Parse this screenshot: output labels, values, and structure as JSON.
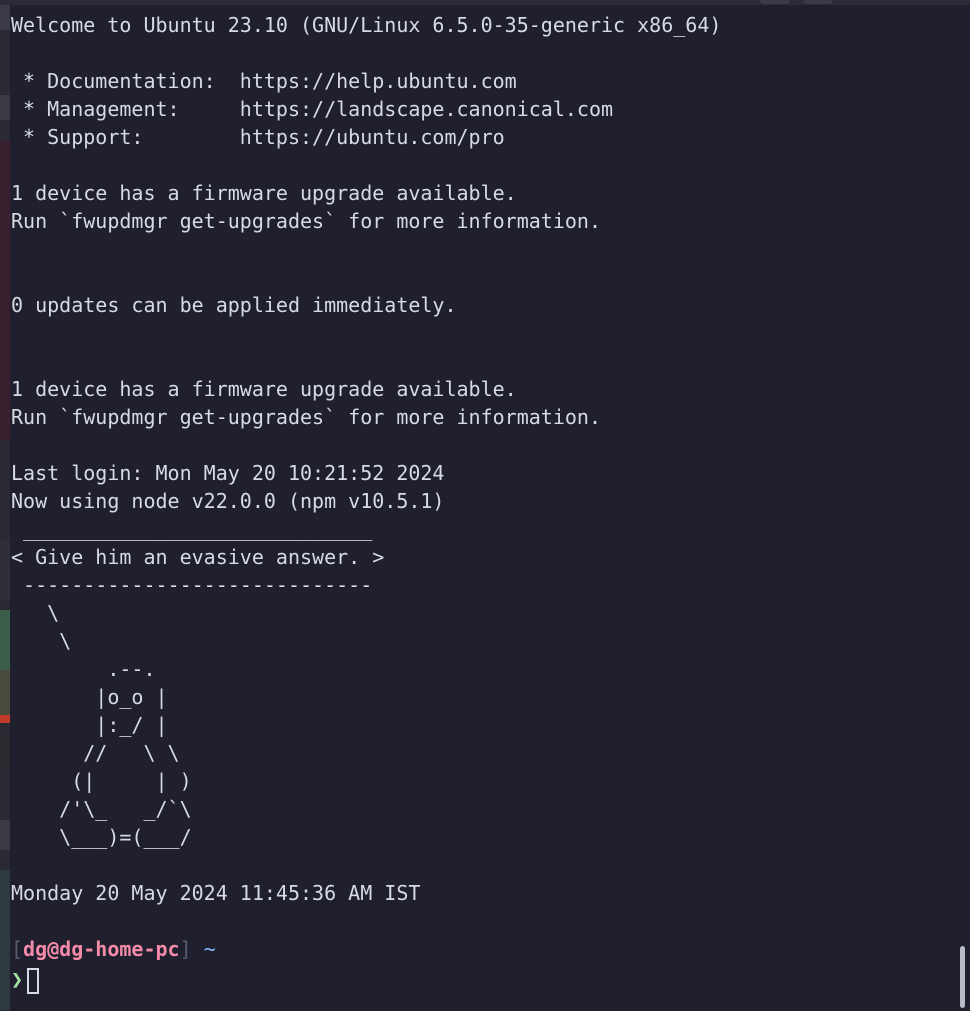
{
  "terminal": {
    "output_lines": [
      "Welcome to Ubuntu 23.10 (GNU/Linux 6.5.0-35-generic x86_64)",
      "",
      " * Documentation:  https://help.ubuntu.com",
      " * Management:     https://landscape.canonical.com",
      " * Support:        https://ubuntu.com/pro",
      "",
      "1 device has a firmware upgrade available.",
      "Run `fwupdmgr get-upgrades` for more information.",
      "",
      "",
      "0 updates can be applied immediately.",
      "",
      "",
      "1 device has a firmware upgrade available.",
      "Run `fwupdmgr get-upgrades` for more information.",
      "",
      "Last login: Mon May 20 10:21:52 2024",
      "Now using node v22.0.0 (npm v10.5.1)",
      " _____________________________",
      "< Give him an evasive answer. >",
      " -----------------------------",
      "   \\",
      "    \\",
      "        .--.",
      "       |o_o |",
      "       |:_/ |",
      "      //   \\ \\",
      "     (|     | )",
      "    /'\\_   _/`\\",
      "    \\___)=(___/",
      "",
      "Monday 20 May 2024 11:45:36 AM IST"
    ],
    "prompt": {
      "open_bracket": "[",
      "user_host": "dg@dg-home-pc",
      "close_bracket": "]",
      "cwd": "~",
      "symbol": "❯"
    }
  },
  "colors": {
    "background": "#1f1f2e",
    "foreground": "#d8dae3",
    "user_host": "#f38ba8",
    "cwd": "#89b4fa",
    "prompt_symbol": "#a6e3a1"
  }
}
